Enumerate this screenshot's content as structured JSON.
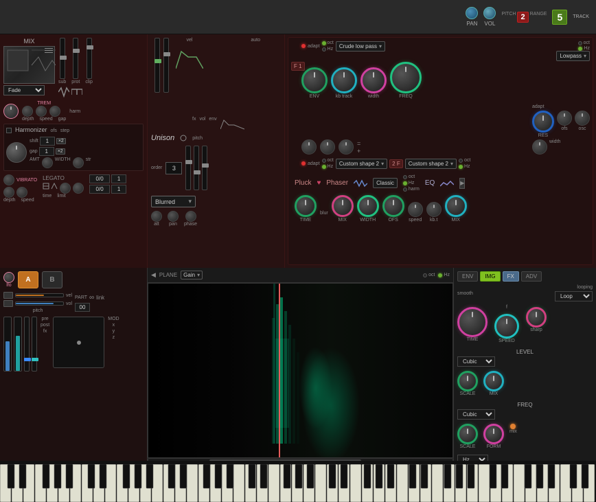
{
  "header": {
    "pan_label": "PAN",
    "vol_label": "VOL",
    "pitch_label": "PITCH",
    "range_label": "RANGE",
    "track_label": "TRACK",
    "pitch_value": "2",
    "track_value": "5"
  },
  "synth": {
    "mix_label": "MIX",
    "fade_label": "Fade",
    "sub_label": "sub",
    "prot_label": "prot",
    "clip_label": "clip",
    "fx_label": "fx",
    "vol_label": "vol",
    "env_label": "env",
    "trem_label": "TREM",
    "harm_label": "harm",
    "depth_label": "depth",
    "speed_label": "speed",
    "gap_label": "gap",
    "vel_label": "vel",
    "auto_label": "auto",
    "unison_label": "Unison",
    "pitch_label": "pitch",
    "order_label": "order",
    "blurred_label": "Blurred",
    "att_label": "att",
    "pan_label": "pan",
    "phase_label": "phase",
    "harmonizer_label": "Harmonizer",
    "ofs_label": "ofs",
    "step_label": "step",
    "shift_label": "shift",
    "gap_h_label": "gap",
    "amt_label": "AMT",
    "width_label": "WIDTH",
    "str_label": "str",
    "vibrato_label": "VIBRATO",
    "depth2_label": "depth",
    "speed2_label": "speed",
    "legato_label": "LEGATO",
    "time_label": "time",
    "limit_label": "limit",
    "adapt_label": "adapt",
    "oct_label": "oct",
    "hz_label": "Hz",
    "crude_low_pass": "Crude low pass",
    "lowpass_label": "Lowpass",
    "env_knob_label": "ENV",
    "kb_track_label": "kb track",
    "width2_label": "width",
    "freq_label": "FREQ",
    "res_label": "RES",
    "adapt2_label": "adapt",
    "ofs_label2": "ofs",
    "osc_label": "osc",
    "custom_shape_2a": "Custom shape 2",
    "custom_shape_2b": "Custom shape 2",
    "pluck_label": "Pluck",
    "phaser_label": "Phaser",
    "classic_label": "Classic",
    "eq_label": "EQ",
    "time2_label": "TIME",
    "blur_label": "blur",
    "mix2_label": "MIX",
    "width3_label": "WIDTH",
    "ofs2_label": "OFS",
    "speed2b_label": "speed",
    "kbt_label": "kb.t",
    "mix3_label": "MIX",
    "filter1_label": "F 1",
    "filter2_label": "2 F"
  },
  "bottom": {
    "lfo_label": "lfo",
    "vel_label": "vel",
    "vol_label": "vol",
    "pitch_label": "pitch",
    "part_label": "PART",
    "link_label": "link",
    "mod_label": "MOD",
    "x_label": "x",
    "y_label": "y",
    "z_label": "z",
    "pre_label": "pre",
    "post_label": "post",
    "fx_label": "fx",
    "a_label": "A",
    "b_label": "B",
    "plane_label": "PLANE",
    "gain_label": "Gain",
    "oct_label": "oct",
    "hz_label": "Hz"
  },
  "env_panel": {
    "env_tab": "ENV",
    "img_tab": "IMG",
    "fx_tab": "FX",
    "adv_tab": "ADV",
    "smooth_label": "smooth",
    "looping_label": "looping",
    "loop_option": "Loop",
    "time_label": "TIME",
    "speed_label": "SPEED",
    "sharp_label": "sharp",
    "level_label": "LEVEL",
    "scale_label": "SCALE",
    "mix_label": "MIX",
    "freq_label": "FREQ",
    "scale2_label": "SCALE",
    "form_label": "FORM",
    "mix2_label": "mix",
    "cubic_label": "Cubic",
    "hz_label": "Hz",
    "f_label": "f"
  }
}
